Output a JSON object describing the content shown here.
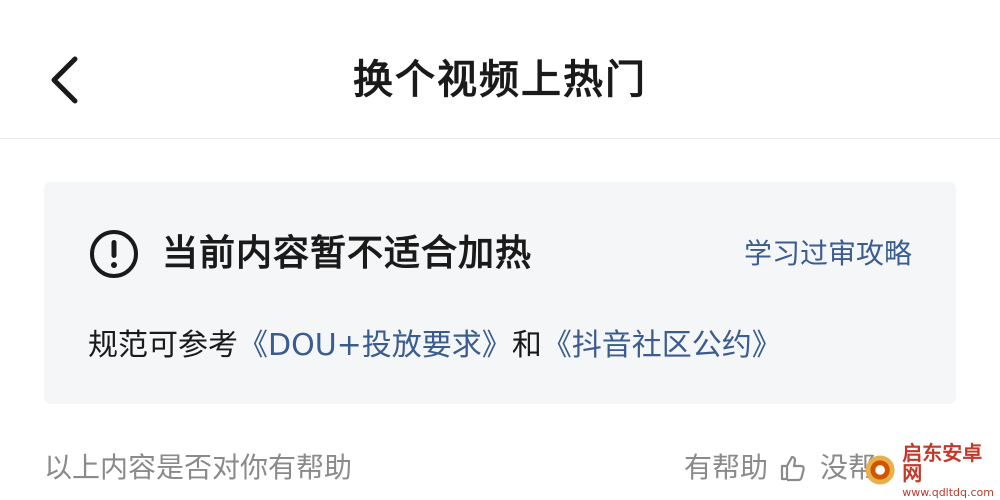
{
  "header": {
    "title": "换个视频上热门"
  },
  "notice": {
    "title": "当前内容暂不适合加热",
    "link": "学习过审攻略",
    "desc_prefix": "规范可参考",
    "rule_link_1": "《DOU+投放要求》",
    "desc_middle": "和",
    "rule_link_2": "《抖音社区公约》"
  },
  "feedback": {
    "question": "以上内容是否对你有帮助",
    "helpful": "有帮助",
    "not_helpful": "没帮"
  },
  "watermark": {
    "main": "启东安卓网",
    "sub": "www.qdltdq.com"
  },
  "colors": {
    "link": "#3a5c8f",
    "card_bg": "#f5f6f8",
    "muted": "#8a8a8a"
  }
}
